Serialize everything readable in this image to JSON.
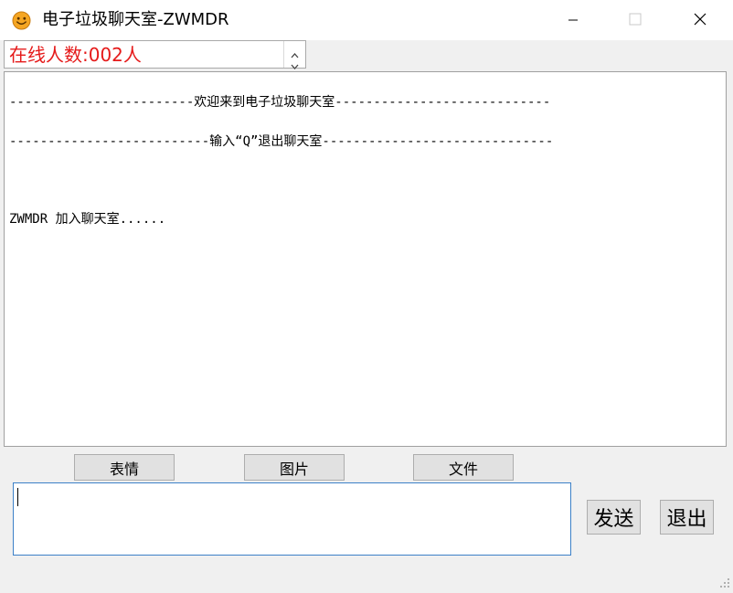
{
  "window": {
    "title": "电子垃圾聊天室-ZWMDR",
    "app_icon": "smiley-face-icon",
    "controls": {
      "minimize_icon": "minimize-icon",
      "maximize_icon": "maximize-icon",
      "close_icon": "close-icon"
    }
  },
  "online": {
    "text": "在线人数:002人",
    "color": "#e51a1a"
  },
  "chat_log": {
    "lines": [
      "------------------------欢迎来到电子垃圾聊天室----------------------------",
      "--------------------------输入“Q”退出聊天室------------------------------",
      "ZWMDR 加入聊天室......"
    ]
  },
  "toolbar": {
    "emoji_label": "表情",
    "image_label": "图片",
    "file_label": "文件"
  },
  "input": {
    "value": "",
    "placeholder": ""
  },
  "actions": {
    "send_label": "发送",
    "quit_label": "退出"
  },
  "colors": {
    "accent_border": "#3c80c8",
    "window_bg": "#f0f0f0"
  }
}
